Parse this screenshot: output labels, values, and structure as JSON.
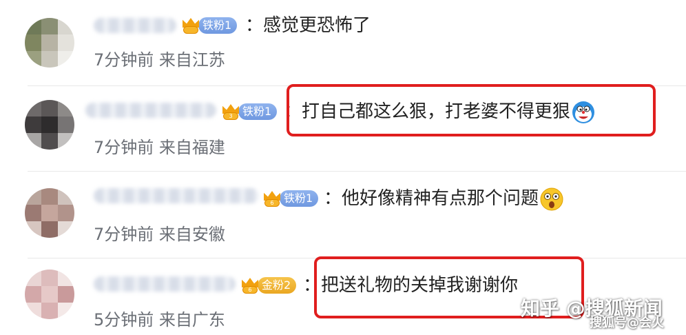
{
  "colors": {
    "highlight_box": "#e01e1e",
    "iron_badge": "#7aa3e6",
    "gold_badge": "#f0b331",
    "meta_text": "#6b6f76"
  },
  "comments": [
    {
      "badge": {
        "label": "铁粉1",
        "crown_level": ""
      },
      "separator": "：",
      "text": "感觉更恐怖了",
      "emoji": "",
      "meta": "7分钟前 来自江苏",
      "highlighted": false
    },
    {
      "badge": {
        "label": "铁粉1",
        "crown_level": "3"
      },
      "separator": "：",
      "text": "打自己都这么狠，打老婆不得更狠",
      "emoji": "doraemon-emoji",
      "meta": "7分钟前 来自福建",
      "highlighted": true
    },
    {
      "badge": {
        "label": "铁粉1",
        "crown_level": "6"
      },
      "separator": "：",
      "text": "他好像精神有点那个问题",
      "emoji": "shocked-face-emoji",
      "meta": "7分钟前 来自安徽",
      "highlighted": false
    },
    {
      "badge": {
        "label": "金粉2",
        "crown_level": "6"
      },
      "separator": "：",
      "text": "把送礼物的关掉我谢谢你",
      "emoji": "",
      "meta": "5分钟前 来自广东",
      "highlighted": true
    }
  ],
  "watermarks": {
    "primary": "知乎 @搜狐新闻",
    "secondary": "搜狐号@会火"
  }
}
